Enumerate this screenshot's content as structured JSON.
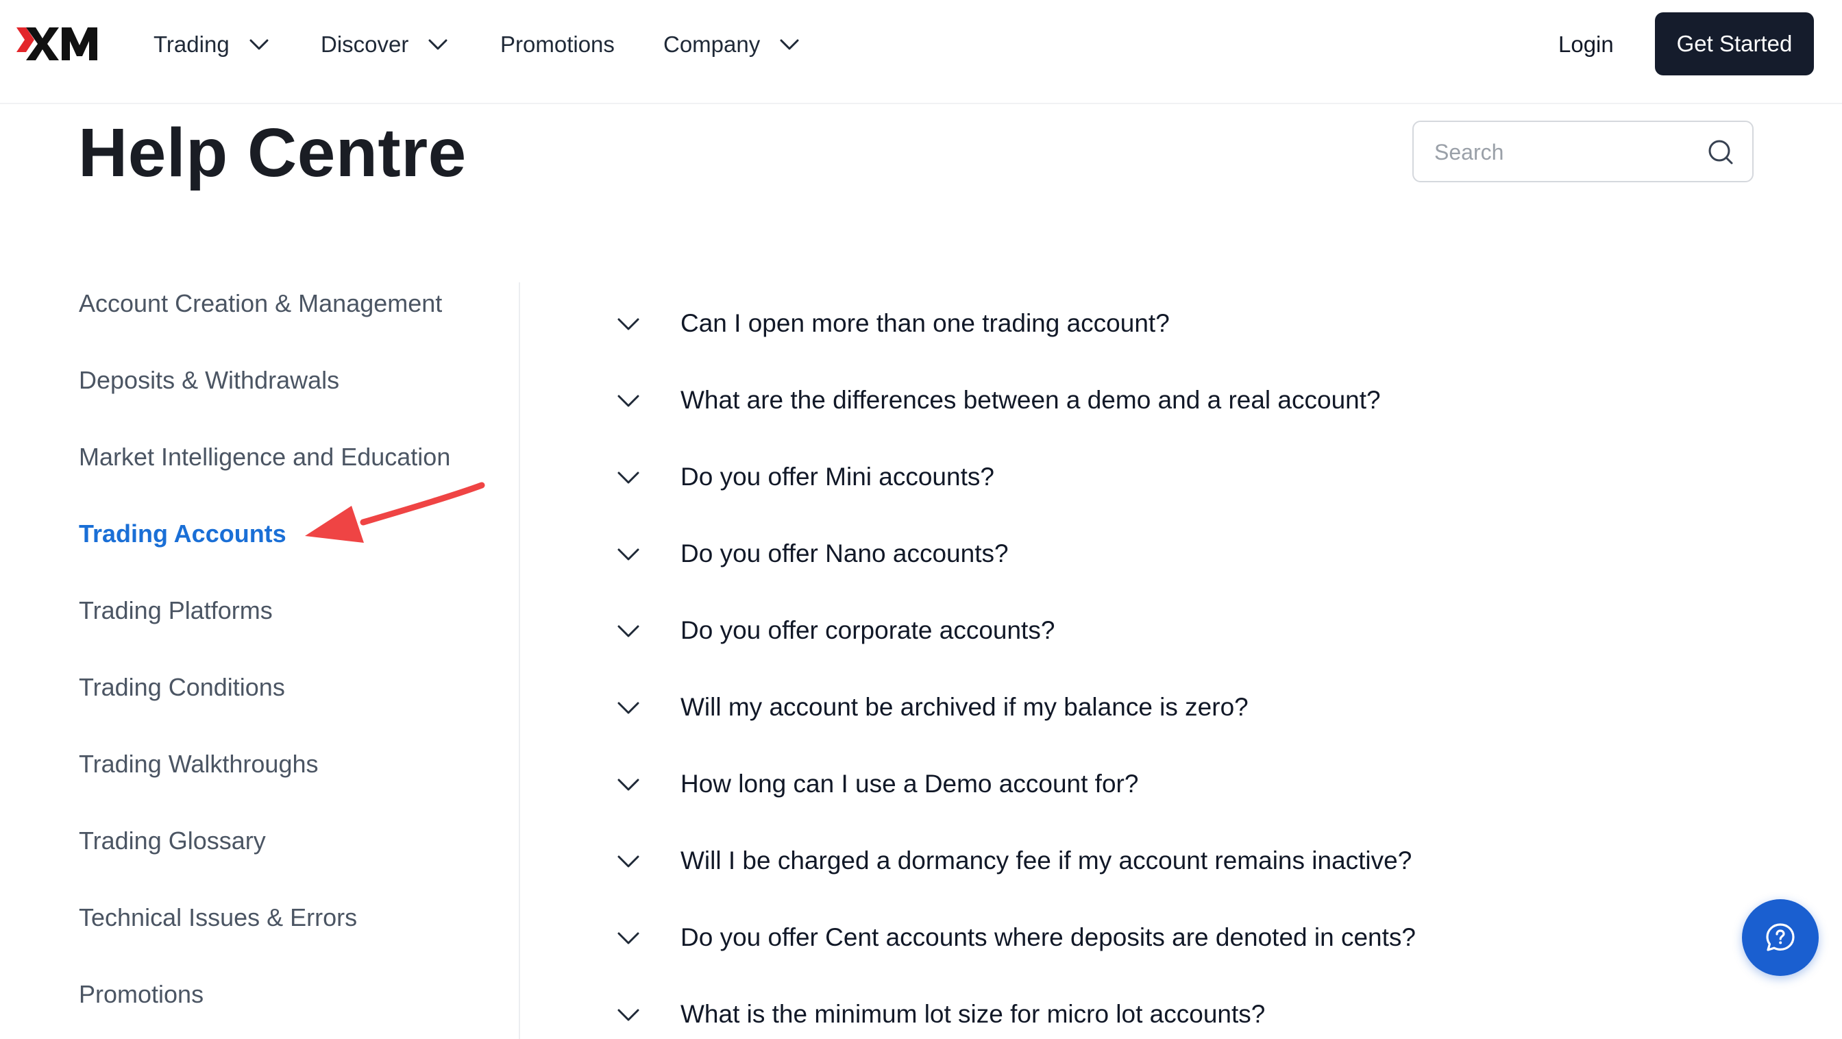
{
  "header": {
    "logo_text": "XM",
    "nav": [
      {
        "label": "Trading",
        "has_dropdown": true
      },
      {
        "label": "Discover",
        "has_dropdown": true
      },
      {
        "label": "Promotions",
        "has_dropdown": false
      },
      {
        "label": "Company",
        "has_dropdown": true
      }
    ],
    "login_label": "Login",
    "cta_label": "Get Started"
  },
  "page": {
    "title": "Help Centre",
    "search": {
      "placeholder": "Search",
      "value": ""
    }
  },
  "sidebar": {
    "items": [
      {
        "label": "Account Creation & Management",
        "active": false
      },
      {
        "label": "Deposits & Withdrawals",
        "active": false
      },
      {
        "label": "Market Intelligence and Education",
        "active": false
      },
      {
        "label": "Trading Accounts",
        "active": true
      },
      {
        "label": "Trading Platforms",
        "active": false
      },
      {
        "label": "Trading Conditions",
        "active": false
      },
      {
        "label": "Trading Walkthroughs",
        "active": false
      },
      {
        "label": "Trading Glossary",
        "active": false
      },
      {
        "label": "Technical Issues & Errors",
        "active": false
      },
      {
        "label": "Promotions",
        "active": false
      }
    ]
  },
  "faq": {
    "questions": [
      "Can I open more than one trading account?",
      "What are the differences between a demo and a real account?",
      "Do you offer Mini accounts?",
      "Do you offer Nano accounts?",
      "Do you offer corporate accounts?",
      "Will my account be archived if my balance is zero?",
      "How long can I use a Demo account for?",
      "Will I be charged a dormancy fee if my account remains inactive?",
      "Do you offer Cent accounts where deposits are denoted in cents?",
      "What is the minimum lot size for micro lot accounts?"
    ]
  },
  "colors": {
    "accent": "#1a6fd6",
    "cta_bg": "#151c2c",
    "chat_bg": "#1a5fd0",
    "logo_red": "#e3262b",
    "annotation_arrow": "#ef4444"
  },
  "icons": {
    "nav_dropdown": "chevron-down-icon",
    "search": "search-icon",
    "faq_toggle": "chevron-down-icon",
    "chat": "chat-help-icon",
    "annotation": "red-arrow-annotation"
  }
}
